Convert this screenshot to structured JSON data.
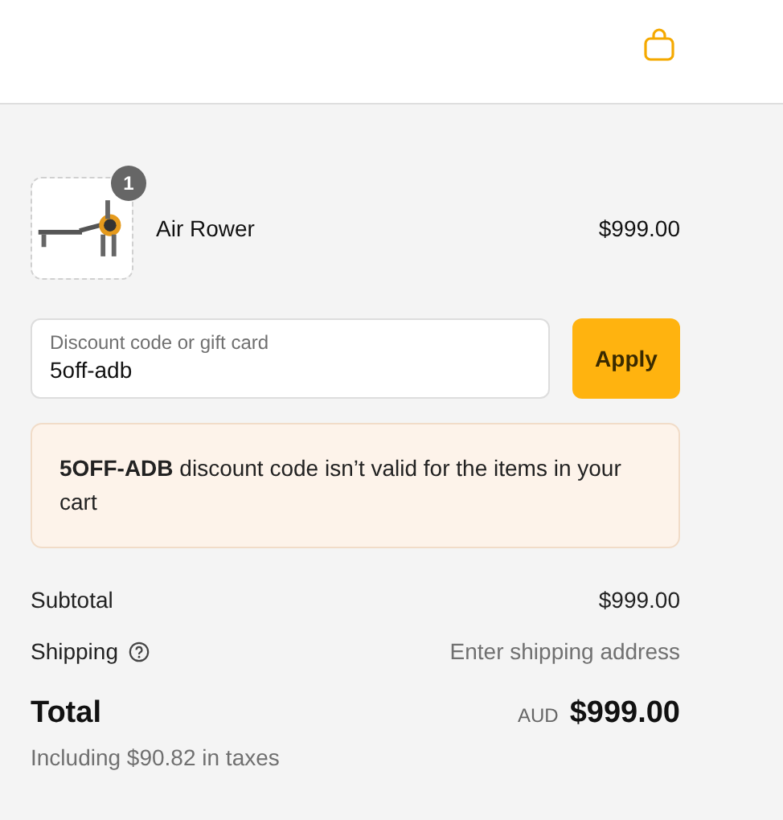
{
  "product": {
    "quantity": "1",
    "name": "Air Rower",
    "price": "$999.00"
  },
  "discount": {
    "label": "Discount code or gift card",
    "value": "5off-adb",
    "button": "Apply"
  },
  "alert": {
    "text": "**5OFF-ADB** discount code isn’t valid for the items in your cart"
  },
  "summary": {
    "rows": [
      {
        "label": "Subtotal",
        "value": "$999.00",
        "kind": "amount",
        "help": false
      },
      {
        "label": "Shipping",
        "value": "Enter shipping address",
        "kind": "hint",
        "help": true
      }
    ],
    "total": {
      "label": "Total",
      "currency": "AUD",
      "amount": "$999.00"
    },
    "taxes": "Including $90.82 in taxes"
  }
}
